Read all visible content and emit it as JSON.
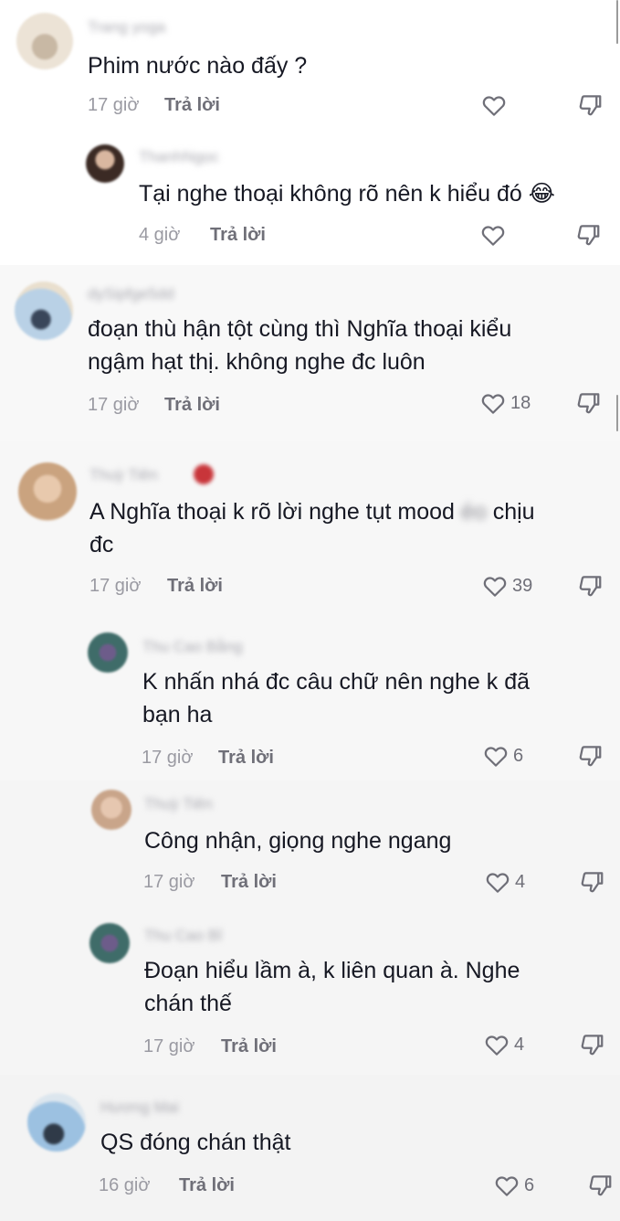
{
  "colors": {
    "band": "#f7f7f7",
    "text": "#161823",
    "muted": "#9a9aa2",
    "reply": "#6f6f78"
  },
  "icons": {
    "like": "heart-outline-icon",
    "dislike": "thumbs-down-outline-icon",
    "emoji": "laughing-tears-emoji"
  },
  "reply_label": "Trả lời",
  "comments": [
    {
      "username": "Trang yoga",
      "lines": [
        "Phim nước nào đấy ?"
      ],
      "time": "17 giờ",
      "likes": ""
    },
    {
      "username": "ThanhNgọc",
      "lines": [
        "Tại nghe thoại không rõ nên k hiểu đó"
      ],
      "emoji": "😂",
      "time": "4 giờ",
      "likes": ""
    },
    {
      "username": "dySipfge5dd",
      "lines": [
        "đoạn thù hận tột cùng thì Nghĩa thoại kiểu",
        "ngậm hạt thị. không nghe đc luôn"
      ],
      "time": "17 giờ",
      "likes": "18"
    },
    {
      "username": "Thuỳ Tiên",
      "line1_prefix": "A Nghĩa thoại k rõ lời nghe tụt mood",
      "line1_blur": "éo",
      "line1_suffix": "chịu",
      "line2": "đc",
      "time": "17 giờ",
      "likes": "39"
    },
    {
      "username": "Thu Cao Bằng",
      "lines": [
        "K nhấn nhá đc câu chữ nên nghe k đã",
        "bạn ha"
      ],
      "time": "17 giờ",
      "likes": "6"
    },
    {
      "username": "Thuỳ Tiên",
      "lines": [
        "Công nhận, giọng nghe ngang"
      ],
      "time": "17 giờ",
      "likes": "4"
    },
    {
      "username": "Thu Cao Bỉ",
      "lines": [
        "Đoạn hiểu lầm à, k liên quan à. Nghe",
        "chán thế"
      ],
      "time": "17 giờ",
      "likes": "4"
    },
    {
      "username": "Hương Mai",
      "lines": [
        "QS đóng chán thật"
      ],
      "time": "16 giờ",
      "likes": "6"
    }
  ]
}
